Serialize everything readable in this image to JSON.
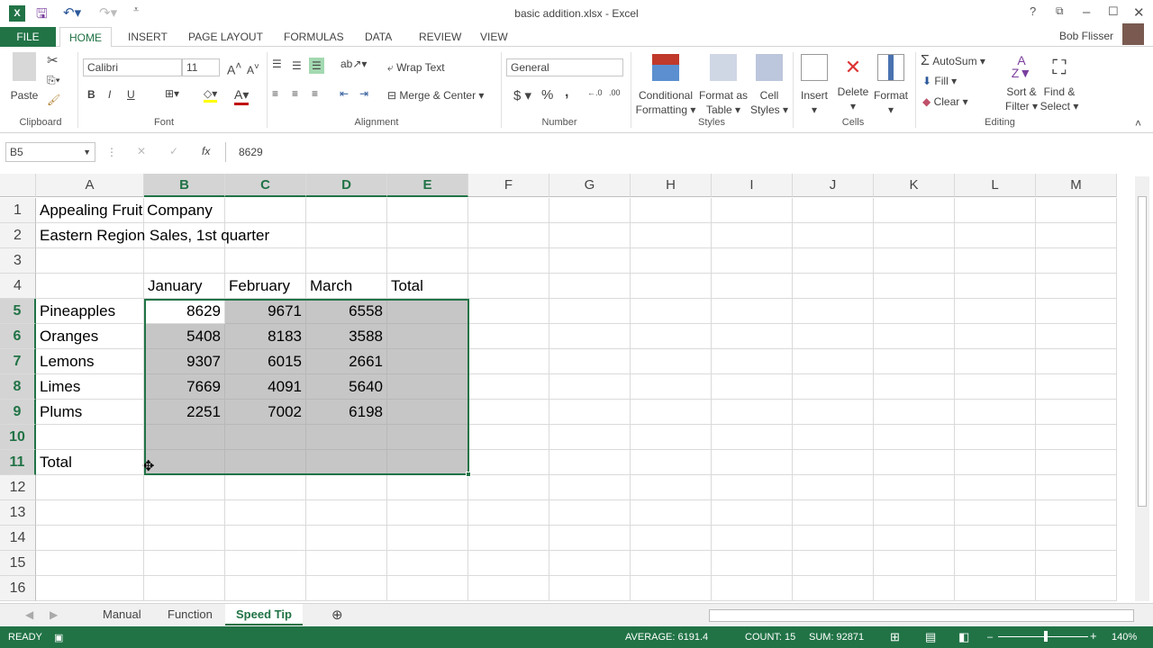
{
  "title": "basic addition.xlsx - Excel",
  "user": "Bob Flisser",
  "tabs": [
    "FILE",
    "HOME",
    "INSERT",
    "PAGE LAYOUT",
    "FORMULAS",
    "DATA",
    "REVIEW",
    "VIEW"
  ],
  "ribbon": {
    "clipboard": {
      "paste": "Paste",
      "label": "Clipboard"
    },
    "font": {
      "name": "Calibri",
      "size": "11",
      "bold": "B",
      "italic": "I",
      "underline": "U",
      "label": "Font"
    },
    "alignment": {
      "wrap": "Wrap Text",
      "merge": "Merge & Center",
      "label": "Alignment"
    },
    "number": {
      "format": "General",
      "currency": "$",
      "percent": "%",
      "comma": ",",
      "label": "Number"
    },
    "styles": {
      "conditional": [
        "Conditional",
        "Formatting ▾"
      ],
      "table": [
        "Format as",
        "Table ▾"
      ],
      "cell": [
        "Cell",
        "Styles ▾"
      ],
      "label": "Styles"
    },
    "cells": {
      "insert": "Insert",
      "delete": "Delete",
      "format": "Format",
      "label": "Cells"
    },
    "editing": {
      "autosum": "AutoSum",
      "fill": "Fill ▾",
      "clear": "Clear ▾",
      "sort": [
        "Sort &",
        "Filter ▾"
      ],
      "find": [
        "Find &",
        "Select ▾"
      ],
      "label": "Editing"
    }
  },
  "formula_bar": {
    "name_box": "B5",
    "fx": "fx",
    "value": "8629"
  },
  "columns": [
    "A",
    "B",
    "C",
    "D",
    "E",
    "F",
    "G",
    "H",
    "I",
    "J",
    "K",
    "L",
    "M"
  ],
  "rows": [
    [
      "Appealing Fruit Company",
      "",
      "",
      "",
      ""
    ],
    [
      "Eastern Region Sales, 1st quarter",
      "",
      "",
      "",
      ""
    ],
    [
      "",
      "",
      "",
      "",
      ""
    ],
    [
      "",
      "January",
      "February",
      "March",
      "Total"
    ],
    [
      "Pineapples",
      "8629",
      "9671",
      "6558",
      ""
    ],
    [
      "Oranges",
      "5408",
      "8183",
      "3588",
      ""
    ],
    [
      "Lemons",
      "9307",
      "6015",
      "2661",
      ""
    ],
    [
      "Limes",
      "7669",
      "4091",
      "5640",
      ""
    ],
    [
      "Plums",
      "2251",
      "7002",
      "6198",
      ""
    ],
    [
      "",
      "",
      "",
      "",
      ""
    ],
    [
      "Total",
      "",
      "",
      "",
      ""
    ],
    [
      "",
      "",
      "",
      "",
      ""
    ],
    [
      "",
      "",
      "",
      "",
      ""
    ],
    [
      "",
      "",
      "",
      "",
      ""
    ],
    [
      "",
      "",
      "",
      "",
      ""
    ],
    [
      "",
      "",
      "",
      "",
      ""
    ]
  ],
  "sheets": [
    "Manual",
    "Function",
    "Speed Tip"
  ],
  "active_sheet": "Speed Tip",
  "status": {
    "mode": "READY",
    "average": "AVERAGE: 6191.4",
    "count": "COUNT: 15",
    "sum": "SUM: 92871",
    "zoom": "140%"
  },
  "colors": {
    "accent": "#217346",
    "selection": "#c6c6c6"
  }
}
